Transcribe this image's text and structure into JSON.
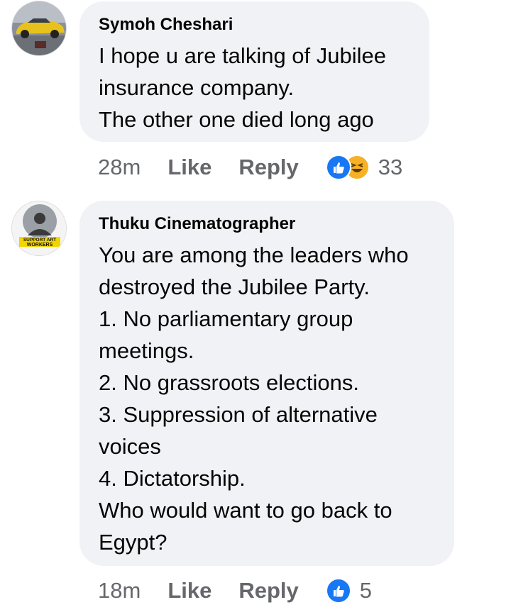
{
  "comments": [
    {
      "author": "Symoh Cheshari",
      "lines": [
        "I hope u are talking of Jubilee",
        "insurance company.",
        "The other one died long ago"
      ],
      "time": "28m",
      "like_label": "Like",
      "reply_label": "Reply",
      "reactions": [
        "like-icon",
        "haha-icon"
      ],
      "reaction_count": "33"
    },
    {
      "author": "Thuku Cinematographer",
      "avatar_text": [
        "SUPPORT ART",
        "WORKERS"
      ],
      "lines": [
        "You are among the leaders who",
        "destroyed the Jubilee Party.",
        "1. No parliamentary group",
        "meetings.",
        "2. No grassroots elections.",
        "3. Suppression of alternative",
        "voices",
        "4. Dictatorship.",
        "Who would want to go back to",
        "Egypt?"
      ],
      "time": "18m",
      "like_label": "Like",
      "reply_label": "Reply",
      "reactions": [
        "like-icon"
      ],
      "reaction_count": "5"
    }
  ],
  "colors": {
    "bubble": "#f0f2f5",
    "meta_text": "#65676b",
    "like_blue": "#1877f2",
    "haha_yellow": "#f7b125"
  }
}
